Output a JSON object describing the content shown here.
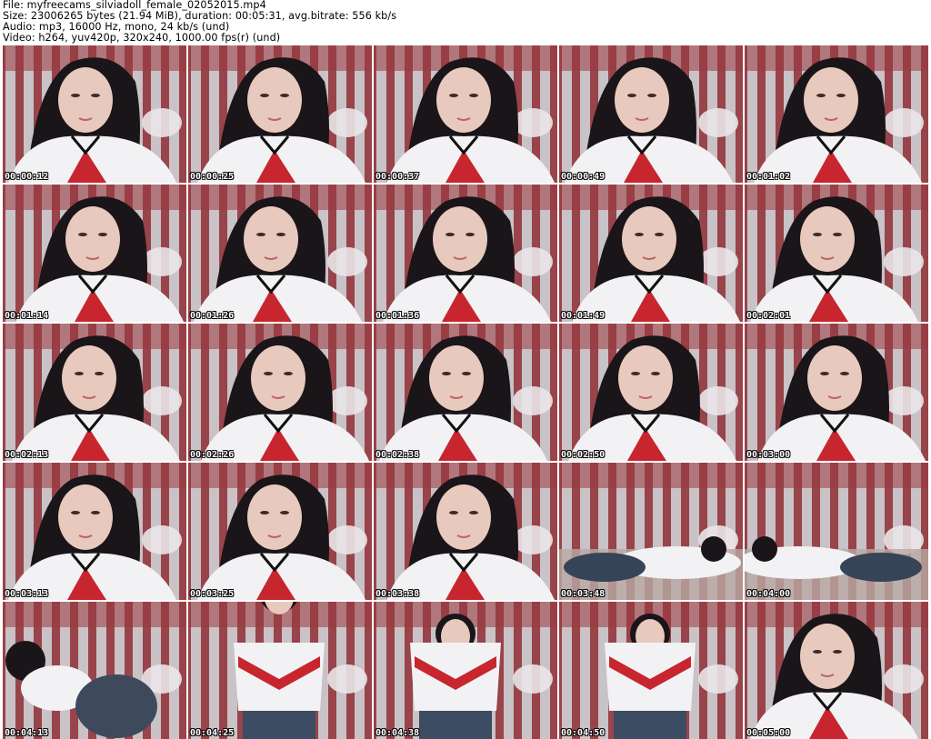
{
  "header": {
    "file": "File: myfreecams_silviadoll_female_02052015.mp4",
    "size": "Size: 23006265 bytes (21.94 MiB), duration: 00:05:31, avg.bitrate: 556 kb/s",
    "audio": "Audio: mp3, 16000 Hz, mono, 24 kb/s (und)",
    "video": "Video: h264, yuv420p, 320x240, 1000.00 fps(r) (und)"
  },
  "thumbnails": [
    {
      "timestamp": "00:00:12",
      "scene": "closeup"
    },
    {
      "timestamp": "00:00:25",
      "scene": "closeup"
    },
    {
      "timestamp": "00:00:37",
      "scene": "closeup"
    },
    {
      "timestamp": "00:00:49",
      "scene": "closeup"
    },
    {
      "timestamp": "00:01:02",
      "scene": "closeup"
    },
    {
      "timestamp": "00:01:14",
      "scene": "closeup"
    },
    {
      "timestamp": "00:01:26",
      "scene": "closeup"
    },
    {
      "timestamp": "00:01:36",
      "scene": "closeup"
    },
    {
      "timestamp": "00:01:49",
      "scene": "closeup"
    },
    {
      "timestamp": "00:02:01",
      "scene": "closeup"
    },
    {
      "timestamp": "00:02:13",
      "scene": "closeup"
    },
    {
      "timestamp": "00:02:26",
      "scene": "closeup"
    },
    {
      "timestamp": "00:02:38",
      "scene": "closeup"
    },
    {
      "timestamp": "00:02:50",
      "scene": "closeup"
    },
    {
      "timestamp": "00:03:00",
      "scene": "closeup"
    },
    {
      "timestamp": "00:03:13",
      "scene": "closeup"
    },
    {
      "timestamp": "00:03:25",
      "scene": "closeup"
    },
    {
      "timestamp": "00:03:38",
      "scene": "closeup"
    },
    {
      "timestamp": "00:03:48",
      "scene": "lying"
    },
    {
      "timestamp": "00:04:00",
      "scene": "lying"
    },
    {
      "timestamp": "00:04:13",
      "scene": "kneeling"
    },
    {
      "timestamp": "00:04:25",
      "scene": "standing"
    },
    {
      "timestamp": "00:04:38",
      "scene": "standing"
    },
    {
      "timestamp": "00:04:50",
      "scene": "standing"
    },
    {
      "timestamp": "00:05:00",
      "scene": "closeup"
    }
  ],
  "colors": {
    "wall": "#c9c2c6",
    "stripe_red": "#8f2e34",
    "hair": "#1a1518",
    "skin": "#e8c9bd",
    "shirt": "#f2f2f4",
    "shirt_red": "#c8262f"
  }
}
